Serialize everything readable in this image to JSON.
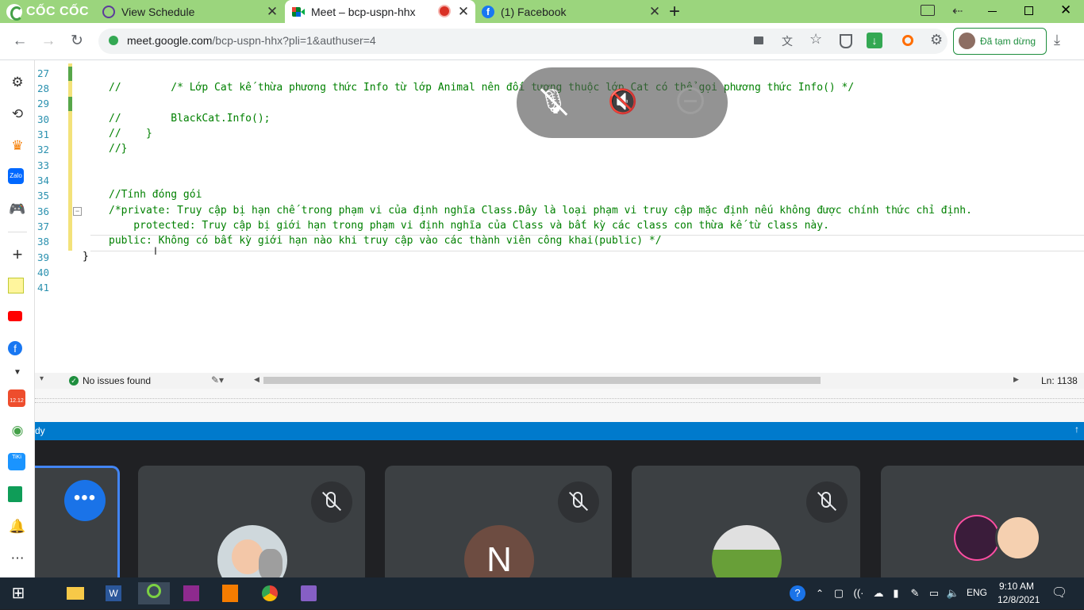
{
  "browser": {
    "brand": "CỐC CỐC",
    "tabs": [
      {
        "title": "View Schedule",
        "icon": "schedule-globe-icon",
        "active": false
      },
      {
        "title": "Meet – bcp-uspn-hhx",
        "icon": "google-meet-icon",
        "active": true,
        "recording": true
      },
      {
        "title": "(1) Facebook",
        "icon": "facebook-icon",
        "active": false
      }
    ],
    "new_tab_symbol": "+",
    "url_host": "meet.google.com",
    "url_rest": "/bcp-uspn-hhx?pli=1&authuser=4",
    "profile_status": "Đã tạm dừng"
  },
  "editor": {
    "lines": [
      {
        "num": "27",
        "text": ""
      },
      {
        "num": "28",
        "text": "//        /* Lớp Cat kế thừa phương thức Info từ lớp Animal nên đối tượng thuộc lớp Cat có thể gọi phương thức Info() */"
      },
      {
        "num": "29",
        "text": ""
      },
      {
        "num": "30",
        "text": "//        BlackCat.Info();"
      },
      {
        "num": "31",
        "text": "//    }"
      },
      {
        "num": "32",
        "text": "//}"
      },
      {
        "num": "33",
        "text": ""
      },
      {
        "num": "34",
        "text": ""
      },
      {
        "num": "35",
        "text": "//Tính đóng gói"
      },
      {
        "num": "36",
        "text": "/*private: Truy cập bị hạn chế trong phạm vi của định nghĩa Class.Đây là loại phạm vi truy cập mặc định nếu không được chính thức chỉ định."
      },
      {
        "num": "37",
        "text": "    protected: Truy cập bị giới hạn trong phạm vi định nghĩa của Class và bất kỳ các class con thừa kế từ class này."
      },
      {
        "num": "38",
        "text": "public: Không có bất kỳ giới hạn nào khi truy cập vào các thành viên công khai(public) */"
      },
      {
        "num": "39",
        "text": "}"
      },
      {
        "num": "40",
        "text": ""
      },
      {
        "num": "41",
        "text": ""
      }
    ],
    "status_text": "No issues found",
    "line_col": "Ln: 1138",
    "blue_bar_text": "dy"
  },
  "meet": {
    "participants": [
      {
        "initial": "",
        "kind": "more-options"
      },
      {
        "initial": "",
        "kind": "photo-baby"
      },
      {
        "initial": "N",
        "kind": "letter"
      },
      {
        "initial": "",
        "kind": "photo-landscape"
      },
      {
        "initial": "",
        "kind": "photo-pair"
      }
    ],
    "avatar_color_n": "#6d4c41"
  },
  "taskbar": {
    "lang": "ENG",
    "time": "9:10 AM",
    "date": "12/8/2021"
  },
  "sidebar": {
    "badge_1212": "12.12",
    "tiki_label": "TiKi"
  },
  "colors": {
    "tabstrip": "#9bd57d",
    "accent_blue": "#007acc",
    "meet_bg": "#202124"
  }
}
